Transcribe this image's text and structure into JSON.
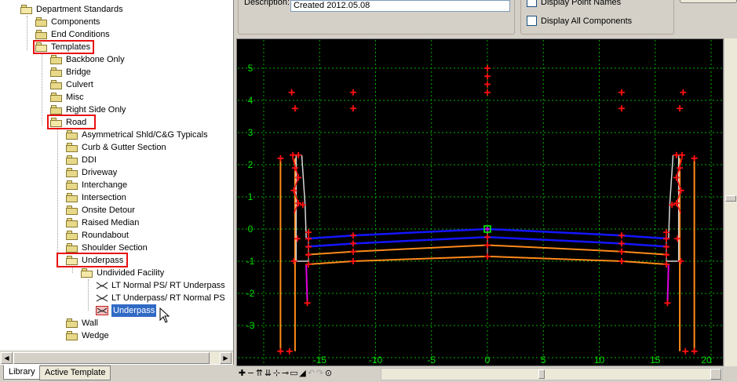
{
  "tree": {
    "root": "Department Standards",
    "components": "Components",
    "end_conditions": "End Conditions",
    "templates": "Templates",
    "templates_children": [
      "Backbone Only",
      "Bridge",
      "Culvert",
      "Misc",
      "Right Side Only"
    ],
    "road": "Road",
    "road_children": [
      "Asymmetrical Shld/C&G Typicals",
      "Curb & Gutter Section",
      "DDI",
      "Driveway",
      "Interchange",
      "Intersection",
      "Onsite Detour",
      "Raised Median",
      "Roundabout",
      "Shoulder Section"
    ],
    "underpass": "Underpass",
    "undivided_facility": "Undivided Facility",
    "undivided_children": [
      "LT Normal PS/ RT Underpass",
      "LT Underpass/ RT Normal PS"
    ],
    "selected_item": "Underpass",
    "after_items": [
      "Wall",
      "Wedge"
    ]
  },
  "bottom_tabs": [
    "Library",
    "Active Template"
  ],
  "form": {
    "description_label": "Description:",
    "description_value": "Created 2012.05.08",
    "display_point_names": "Display Point Names",
    "display_all_components": "Display All Components"
  },
  "view": {
    "x_ticks": [
      "-15",
      "-10",
      "-5",
      "0",
      "5",
      "10",
      "15",
      "20"
    ],
    "y_ticks": [
      "5",
      "4",
      "3",
      "2",
      "1",
      "0",
      "-1",
      "-2",
      "-3"
    ],
    "colors": {
      "background": "#000000",
      "grid": "#00b000",
      "axis_labels": "#00e000",
      "points": "#ff1010",
      "blue_line": "#1515ff",
      "orange_line": "#ff8a1a",
      "magenta_line": "#e000e0",
      "white_line": "#d8d8d8",
      "origin_marker": "#00ff00"
    }
  },
  "toolbar": {
    "tools": [
      "move-tool",
      "zoom-out-tool",
      "fit-tool",
      "pan-tool",
      "pan-tool-2",
      "zoom-in-tool",
      "window-tool",
      "measure-tool",
      "undo-tool",
      "redo-tool",
      "point-tool"
    ]
  }
}
